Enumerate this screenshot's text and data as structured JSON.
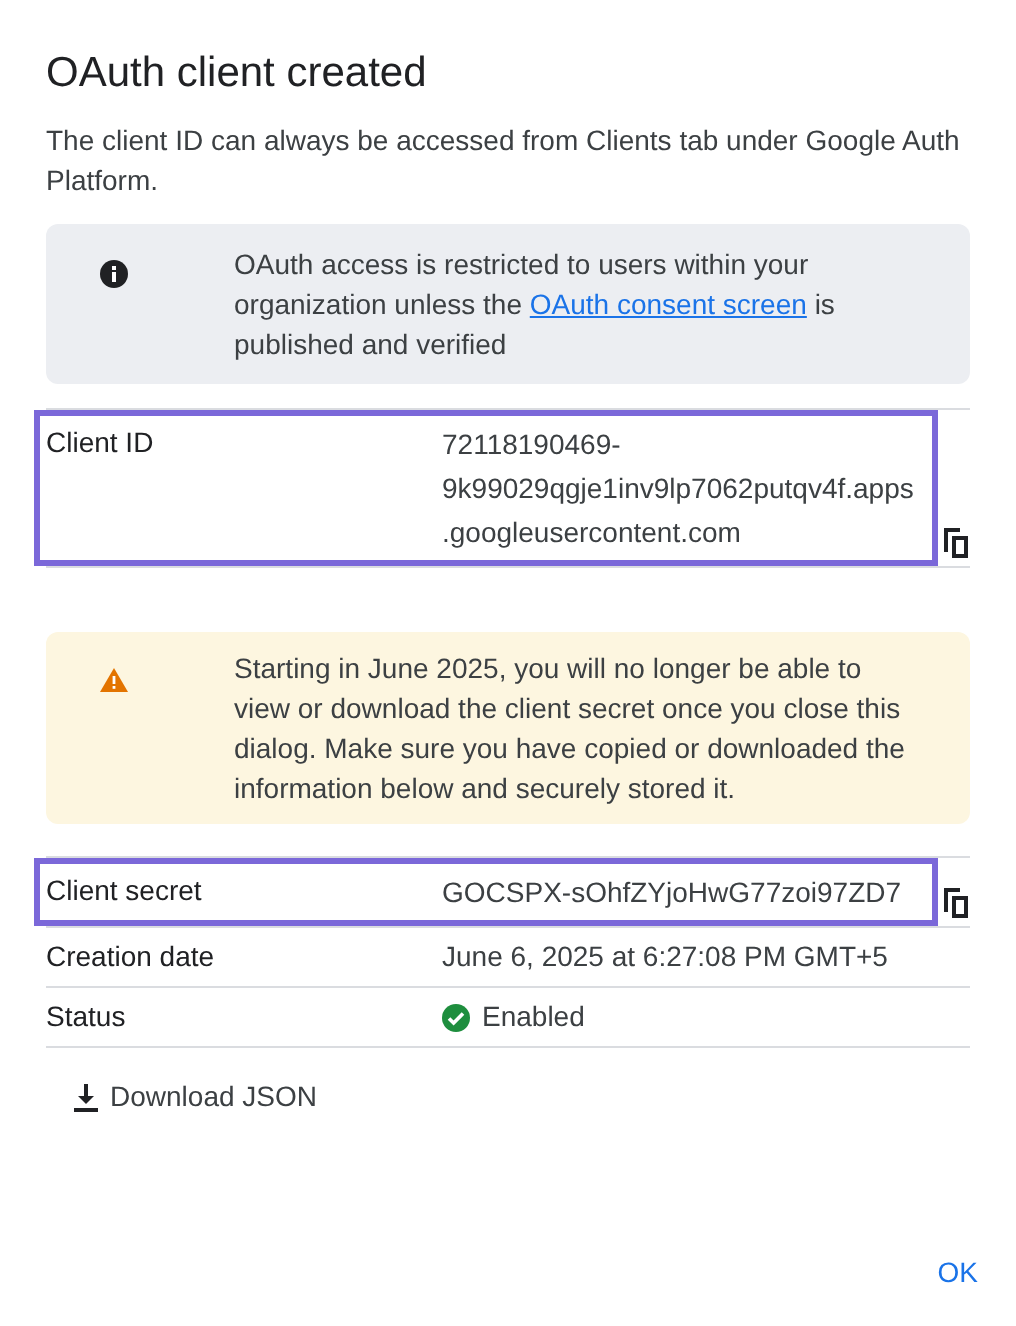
{
  "dialog": {
    "title": "OAuth client created",
    "description": "The client ID can always be accessed from Clients tab under Google Auth Platform."
  },
  "info_notice": {
    "text_before": "OAuth access is restricted to users within your organization unless the",
    "link": "OAuth consent screen",
    "text_after": "is published and verified"
  },
  "client_id": {
    "label": "Client ID",
    "value": "72118190469-9k99029qgje1inv9lp7062putqv4f.apps.googleusercontent.com",
    "highlighted": true
  },
  "warning_notice": {
    "text": "Starting in June 2025, you will no longer be able to view or download the client secret once you close this dialog. Make sure you have copied or downloaded the information below and securely stored it."
  },
  "client_secret": {
    "label": "Client secret",
    "value": "GOCSPX-sOhfZYjoHwG77zoi97ZD7",
    "highlighted": true
  },
  "details": [
    {
      "label": "Creation date",
      "value": "June 6, 2025 at 6:27:08 PM GMT+5",
      "kind": "text"
    },
    {
      "label": "Status",
      "value": "Enabled",
      "kind": "status"
    }
  ],
  "download_button": "Download JSON",
  "ok_button": "OK"
}
